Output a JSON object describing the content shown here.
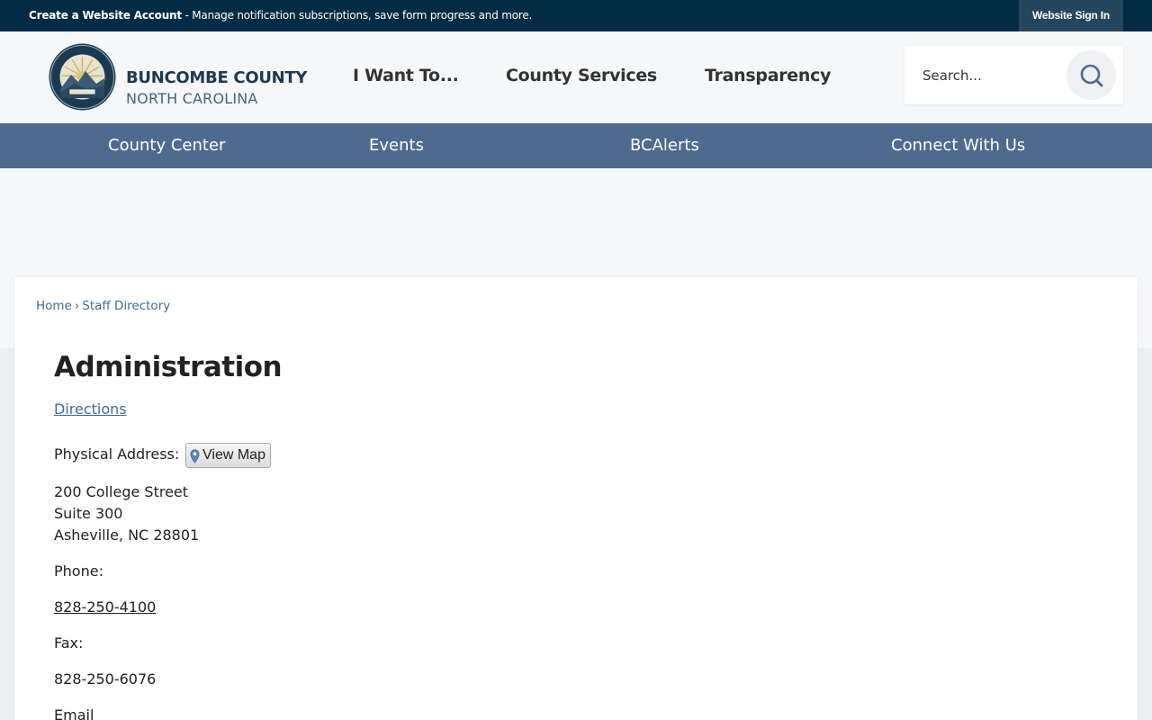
{
  "topbar": {
    "create_bold": "Create a Website Account",
    "create_rest": " - Manage notification subscriptions, save form progress and more.",
    "signin_label": "Website Sign In"
  },
  "logo": {
    "line1": "BUNCOMBE COUNTY",
    "line2": "NORTH CAROLINA"
  },
  "main_nav": [
    "I Want To...",
    "County Services",
    "Transparency"
  ],
  "search": {
    "placeholder": "Search..."
  },
  "sub_nav": [
    "County Center",
    "Events",
    "BCAlerts",
    "Connect With Us"
  ],
  "breadcrumb": {
    "home": "Home",
    "sep": "›",
    "current": "Staff Directory"
  },
  "page": {
    "title": "Administration",
    "directions_label": "Directions",
    "physical_label": "Physical Address:",
    "view_map_label": "View Map",
    "address": [
      "200 College Street",
      "Suite 300",
      "Asheville, NC 28801"
    ],
    "phone_label": "Phone:",
    "phone_value": "828-250-4100",
    "fax_label": "Fax:",
    "fax_value": "828-250-6076",
    "email_label": "Email"
  },
  "colors": {
    "topbar": "#042b45",
    "subnav": "#4f6a8f",
    "link": "#3d6b94"
  }
}
